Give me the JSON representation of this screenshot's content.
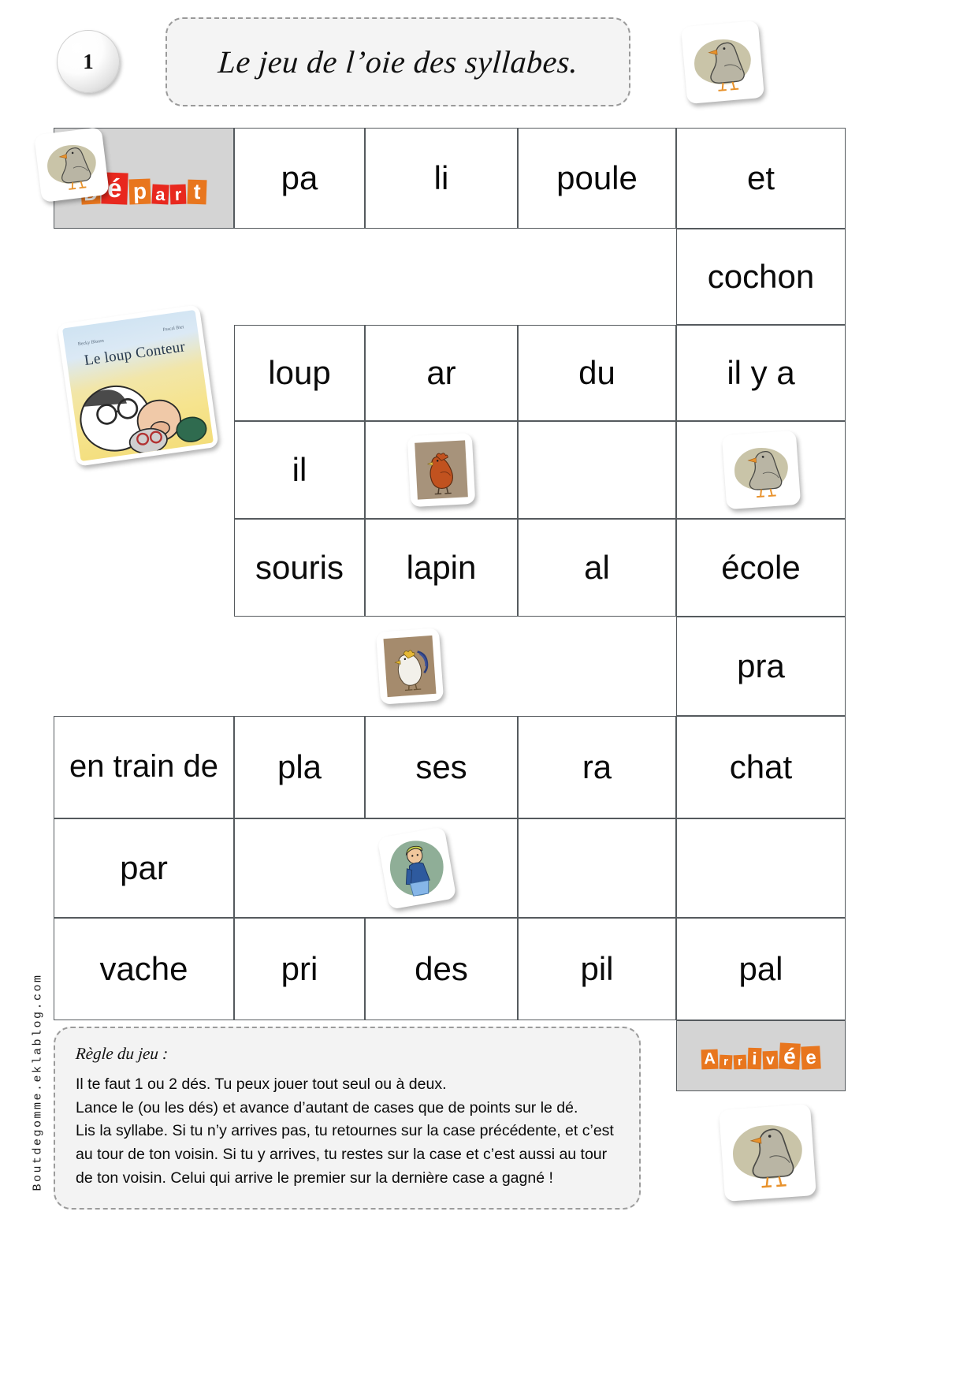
{
  "header": {
    "page_number": "1",
    "title": "Le jeu de l’oie des syllabes."
  },
  "colors": {
    "depart_orange": "#E8761E",
    "depart_red": "#E8281E",
    "arrivee_orange": "#E8761E",
    "cell_grey": "#D4D4D4",
    "border": "#555A5E",
    "panel_bg": "#F3F3F3",
    "dashed_border": "#9B9B9B"
  },
  "board": {
    "start_label": "Départ",
    "start_letters": [
      "D",
      "é",
      "p",
      "a",
      "r",
      "t"
    ],
    "finish_label": "Arrivée",
    "finish_letters": [
      "A",
      "r",
      "r",
      "i",
      "v",
      "é",
      "e"
    ],
    "rows": [
      {
        "row": 1,
        "cells": [
          {
            "text": "Départ",
            "kind": "start",
            "grey": true
          },
          {
            "text": "pa",
            "kind": "word"
          },
          {
            "text": "li",
            "kind": "word"
          },
          {
            "text": "poule",
            "kind": "word"
          },
          {
            "text": "et",
            "kind": "word"
          }
        ]
      },
      {
        "row": 2,
        "cells": [
          {
            "text": "",
            "kind": "empty"
          },
          {
            "text": "",
            "kind": "empty"
          },
          {
            "text": "",
            "kind": "empty"
          },
          {
            "text": "",
            "kind": "empty"
          },
          {
            "text": "cochon",
            "kind": "word"
          }
        ]
      },
      {
        "row": 3,
        "cells": [
          {
            "text": "",
            "kind": "empty"
          },
          {
            "text": "loup",
            "kind": "word"
          },
          {
            "text": "ar",
            "kind": "word"
          },
          {
            "text": "du",
            "kind": "word"
          },
          {
            "text": "il y a",
            "kind": "word"
          }
        ]
      },
      {
        "row": 4,
        "cells": [
          {
            "text": "",
            "kind": "empty"
          },
          {
            "text": "il",
            "kind": "word"
          },
          {
            "text": "",
            "kind": "image",
            "image": "hen-image"
          },
          {
            "text": "",
            "kind": "blank"
          },
          {
            "text": "",
            "kind": "image",
            "image": "goose-image"
          }
        ]
      },
      {
        "row": 5,
        "cells": [
          {
            "text": "",
            "kind": "empty"
          },
          {
            "text": "souris",
            "kind": "word"
          },
          {
            "text": "lapin",
            "kind": "word"
          },
          {
            "text": "al",
            "kind": "word"
          },
          {
            "text": "école",
            "kind": "word"
          }
        ]
      },
      {
        "row": 6,
        "cells": [
          {
            "text": "",
            "kind": "empty"
          },
          {
            "text": "",
            "kind": "image",
            "image": "rooster-image"
          },
          {
            "text": "",
            "kind": "empty"
          },
          {
            "text": "",
            "kind": "empty"
          },
          {
            "text": "pra",
            "kind": "word"
          }
        ]
      },
      {
        "row": 7,
        "cells": [
          {
            "text": "en train de",
            "kind": "word"
          },
          {
            "text": "pla",
            "kind": "word"
          },
          {
            "text": "ses",
            "kind": "word"
          },
          {
            "text": "ra",
            "kind": "word"
          },
          {
            "text": "chat",
            "kind": "word"
          }
        ]
      },
      {
        "row": 8,
        "cells": [
          {
            "text": "par",
            "kind": "word"
          },
          {
            "text": "",
            "kind": "image",
            "image": "boy-image"
          },
          {
            "text": "",
            "kind": "blank"
          },
          {
            "text": "",
            "kind": "blank"
          },
          {
            "text": "",
            "kind": "empty"
          }
        ]
      },
      {
        "row": 9,
        "cells": [
          {
            "text": "vache",
            "kind": "word"
          },
          {
            "text": "pri",
            "kind": "word"
          },
          {
            "text": "des",
            "kind": "word"
          },
          {
            "text": "pil",
            "kind": "word"
          },
          {
            "text": "pal",
            "kind": "word"
          }
        ]
      },
      {
        "row": 10,
        "cells": [
          {
            "text": "",
            "kind": "empty"
          },
          {
            "text": "",
            "kind": "empty"
          },
          {
            "text": "",
            "kind": "empty"
          },
          {
            "text": "",
            "kind": "empty"
          },
          {
            "text": "Arrivée",
            "kind": "finish",
            "grey": true
          }
        ]
      }
    ]
  },
  "images": {
    "goose_header": "goose-image",
    "goose_start": "goose-image",
    "book": {
      "title": "Le loup Conteur",
      "author_left": "Becky Bloom",
      "author_right": "Pascal Biet"
    },
    "hen": "hen-image",
    "rooster": "rooster-image",
    "goose_mid": "goose-image",
    "boy": "boy-image",
    "goose_bottom": "goose-image"
  },
  "rules": {
    "title": "Règle du jeu :",
    "lines": [
      "Il te faut 1 ou 2 dés. Tu peux jouer tout seul ou à deux.",
      "Lance le (ou les dés) et avance d’autant de cases que de points sur le dé.",
      "Lis la syllabe. Si tu n’y arrives pas, tu retournes sur la case précédente, et c’est",
      "au tour de ton voisin. Si tu y arrives, tu restes sur la case et c’est aussi au tour",
      "de ton voisin. Celui qui arrive le premier sur la dernière case a gagné !"
    ]
  },
  "watermark": {
    "text": "Boutdegomme.eklablog.com"
  }
}
